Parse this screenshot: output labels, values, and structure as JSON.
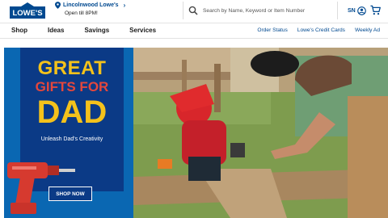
{
  "header": {
    "logo_text": "LOWE'S",
    "store_name": "Lincolnwood Lowe's",
    "store_hours": "Open till 8PM!",
    "search_placeholder": "Search by Name, Keyword or Item Number",
    "account_initials": "SN"
  },
  "nav": {
    "items": [
      "Shop",
      "Ideas",
      "Savings",
      "Services"
    ],
    "links": [
      "Order Status",
      "Lowe's Credit Cards",
      "Weekly Ad"
    ]
  },
  "hero": {
    "line1": "GREAT",
    "line2": "GIFTS FOR",
    "line3": "DAD",
    "subtitle": "Unleash Dad's Creativity",
    "cta": "SHOP NOW"
  },
  "colors": {
    "brand_blue": "#004990",
    "promo_blue": "#0a67b2",
    "promo_dark": "#0b3a86",
    "great_gold": "#f4c21b",
    "gifts_red": "#e4473c"
  },
  "icons": [
    "location-pin-icon",
    "chevron-right-icon",
    "search-icon",
    "account-icon",
    "cart-icon",
    "drill-icon"
  ]
}
